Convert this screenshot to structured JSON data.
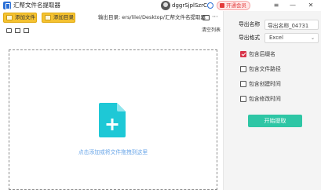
{
  "app": {
    "title": "汇帮文件名提取器"
  },
  "header": {
    "username": "dggrSjplSzrC",
    "vip_label": "开通会员"
  },
  "window_controls": {
    "menu": "≡",
    "minimize": "—",
    "close": "✕"
  },
  "toolbar": {
    "add_file_label": "添加文件",
    "add_folder_label": "添加目录",
    "output_dir_label": "输出目录:",
    "output_dir_value": "ers/lilei/Desktop/汇帮文件名提取器",
    "more_label": "···"
  },
  "list": {
    "clear_label": "清空列表"
  },
  "dropzone": {
    "hint": "点击添加或将文件拖拽到这里"
  },
  "panel": {
    "export_name_label": "导出名称",
    "export_name_value": "导出名称_04731",
    "export_format_label": "导出格式",
    "export_format_value": "Excel",
    "options": [
      {
        "label": "包含后缀名",
        "checked": true
      },
      {
        "label": "包含文件路径",
        "checked": false
      },
      {
        "label": "包含创建时间",
        "checked": false
      },
      {
        "label": "包含修改时间",
        "checked": false
      }
    ],
    "start_label": "开始提取"
  },
  "colors": {
    "accent_button": "#2ec6a5",
    "toolbar_button": "#f5c230",
    "checkbox_checked": "#d8344a",
    "vip": "#e23b3b",
    "hint_text": "#6aa6e8"
  }
}
